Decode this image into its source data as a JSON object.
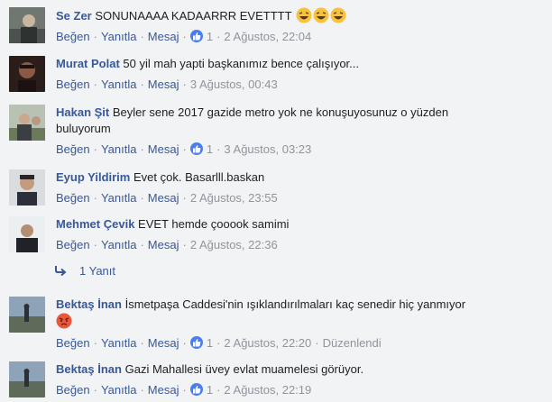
{
  "comments": [
    {
      "name": "Se Zer",
      "text": "SONUNAAAA KADAARRR EVETTTT",
      "emoji": [
        "laughing-face",
        "laughing-face",
        "laughing-face"
      ],
      "like": "Beğen",
      "reply": "Yanıtla",
      "message": "Mesaj",
      "reaction_count": "1",
      "time": "2 Ağustos, 22:04"
    },
    {
      "name": "Murat Polat",
      "text": "50 yil mah yapti başkanımız bence çalışıyor...",
      "like": "Beğen",
      "reply": "Yanıtla",
      "message": "Mesaj",
      "time": "3 Ağustos, 00:43"
    },
    {
      "name": "Hakan Şit",
      "text": "Beyler sene 2017 gazide metro yok ne konuşuyosunuz o yüzden",
      "text_cont": "buluyorum",
      "like": "Beğen",
      "reply": "Yanıtla",
      "message": "Mesaj",
      "reaction_count": "1",
      "time": "3 Ağustos, 03:23"
    },
    {
      "name": "Eyup Yildirim",
      "text": "Evet çok. Basarlll.baskan",
      "like": "Beğen",
      "reply": "Yanıtla",
      "message": "Mesaj",
      "time": "2 Ağustos, 23:55"
    },
    {
      "name": "Mehmet Çevik",
      "text": "EVET hemde çooook samimi",
      "like": "Beğen",
      "reply": "Yanıtla",
      "message": "Mesaj",
      "time": "2 Ağustos, 22:36"
    },
    {
      "name": "Bektaş İnan",
      "text": "İsmetpaşa Caddesi'nin ışıklandırılmaları kaç senedir hiç yanmıyor",
      "emoji": [
        "angry-face"
      ],
      "like": "Beğen",
      "reply": "Yanıtla",
      "message": "Mesaj",
      "reaction_count": "1",
      "time": "2 Ağustos, 22:20",
      "edited": "Düzenlendi"
    },
    {
      "name": "Bektaş İnan",
      "text": "Gazi Mahallesi üvey evlat muamelesi görüyor.",
      "like": "Beğen",
      "reply": "Yanıtla",
      "message": "Mesaj",
      "reaction_count": "1",
      "time": "2 Ağustos, 22:19"
    }
  ],
  "replies_link": {
    "label": "1 Yanıt",
    "icon": "reply-arrow-icon"
  },
  "colors": {
    "background": "#f2f3f5",
    "name": "#385898",
    "link": "#385898",
    "meta": "#90949c",
    "like_badge": "#4a7ef0"
  }
}
